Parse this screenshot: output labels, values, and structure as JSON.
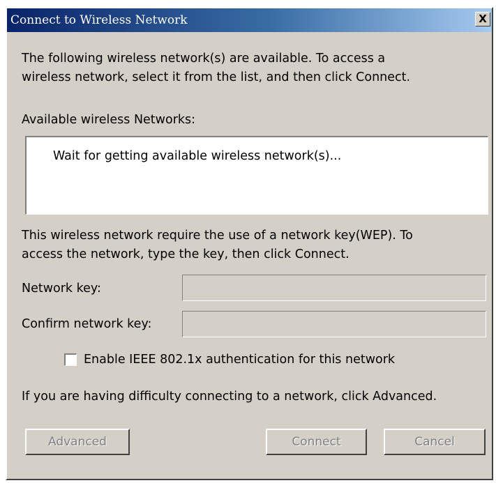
{
  "window": {
    "title": "Connect to Wireless Network",
    "close_label": "X"
  },
  "intro": {
    "line1": "The following wireless network(s) are available. To access a",
    "line2": "wireless network, select it from the list, and then click Connect."
  },
  "networks": {
    "label": "Available wireless Networks:",
    "placeholder": "Wait for getting available wireless network(s)..."
  },
  "key_info": {
    "line1": "This wireless network require the use of a network key(WEP). To",
    "line2": "access the network, type the key, then click Connect."
  },
  "fields": {
    "network_key_label": "Network key:",
    "network_key_value": "",
    "confirm_key_label": "Confirm network key:",
    "confirm_key_value": ""
  },
  "checkbox": {
    "label": "Enable IEEE 802.1x authentication for this network",
    "checked": false
  },
  "advanced_hint": "If you are having difficulty connecting to a network, click Advanced.",
  "buttons": {
    "advanced": "Advanced",
    "connect": "Connect",
    "cancel": "Cancel"
  },
  "colors": {
    "titlebar_start": "#0a246a",
    "titlebar_end": "#a6caf0",
    "dialog_bg": "#d4d0c8",
    "disabled_text": "#808080"
  }
}
